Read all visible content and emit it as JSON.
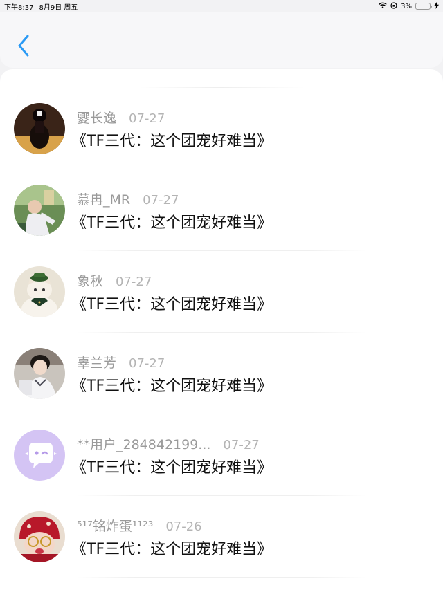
{
  "status_bar": {
    "time": "下午8:37",
    "date": "8月9日 周五",
    "battery_text": "3%",
    "battery_level": 0.03,
    "icons": [
      "wifi-icon",
      "orientation-lock-icon",
      "battery-icon",
      "charging-icon"
    ]
  },
  "nav": {
    "back_icon": "chevron-left-icon",
    "accent_color": "#2a9af5"
  },
  "comments": [
    {
      "user": "夒长逸",
      "date": "07-27",
      "title": "《TF三代：这个团宠好难当》"
    },
    {
      "user": "慕冉_MR",
      "date": "07-27",
      "title": "《TF三代：这个团宠好难当》"
    },
    {
      "user": "象秋",
      "date": "07-27",
      "title": "《TF三代：这个团宠好难当》"
    },
    {
      "user": "辜兰芳",
      "date": "07-27",
      "title": "《TF三代：这个团宠好难当》"
    },
    {
      "user": "**用户_284842199...",
      "date": "07-27",
      "title": "《TF三代：这个团宠好难当》"
    },
    {
      "user": "⁵¹⁷铭炸蛋¹¹²³",
      "date": "07-26",
      "title": "《TF三代：这个团宠好难当》"
    }
  ]
}
